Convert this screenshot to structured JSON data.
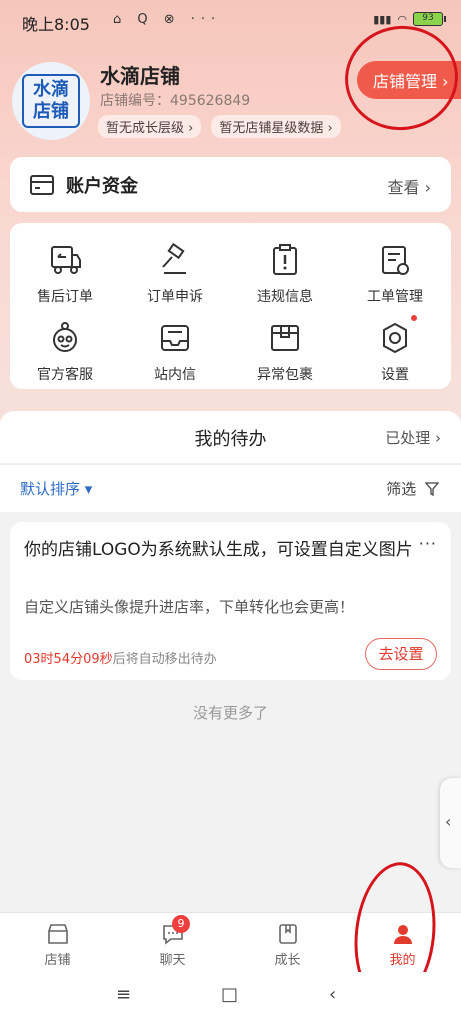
{
  "status_bar": {
    "time": "晚上8:05",
    "icons": "⌂ Q ⊗ ···",
    "battery": "93"
  },
  "header": {
    "avatar_text": [
      "水滴",
      "店铺"
    ],
    "shop_name": "水滴店铺",
    "shop_id": "店铺编号：495626849",
    "tags": [
      "暂无成长层级 ›",
      "暂无店铺星级数据 ›"
    ],
    "manage_label": "店铺管理 ›"
  },
  "funds": {
    "title": "账户资金",
    "view": "查看 ›"
  },
  "grid": [
    {
      "label": "售后订单",
      "icon": "truck-return-icon"
    },
    {
      "label": "订单申诉",
      "icon": "gavel-icon"
    },
    {
      "label": "违规信息",
      "icon": "clipboard-alert-icon"
    },
    {
      "label": "工单管理",
      "icon": "document-gear-icon"
    },
    {
      "label": "官方客服",
      "icon": "customer-service-icon"
    },
    {
      "label": "站内信",
      "icon": "inbox-icon"
    },
    {
      "label": "异常包裹",
      "icon": "package-icon"
    },
    {
      "label": "设置",
      "icon": "settings-icon"
    }
  ],
  "todo": {
    "title": "我的待办",
    "done": "已处理 ›",
    "sort": "默认排序 ▾",
    "filter": "筛选",
    "card": {
      "title": "你的店铺LOGO为系统默认生成，可设置自定义图片",
      "more": "···",
      "desc": "自定义店铺头像提升进店率，下单转化也会更高！",
      "timer_red": "03时54分09秒",
      "timer_rest": "后将自动移出待办",
      "button": "去设置"
    },
    "no_more": "没有更多了"
  },
  "nav": {
    "items": [
      {
        "label": "店铺",
        "icon": "shop-icon"
      },
      {
        "label": "聊天",
        "icon": "chat-icon",
        "badge": "9"
      },
      {
        "label": "成长",
        "icon": "bookmark-icon"
      },
      {
        "label": "我的",
        "icon": "user-icon"
      }
    ]
  },
  "system_nav": {
    "menu": "≡",
    "home": "□",
    "back": "‹"
  },
  "colors": {
    "accent": "#ef5a4a",
    "link": "#2b6cc4",
    "annotation": "#d6141c"
  }
}
